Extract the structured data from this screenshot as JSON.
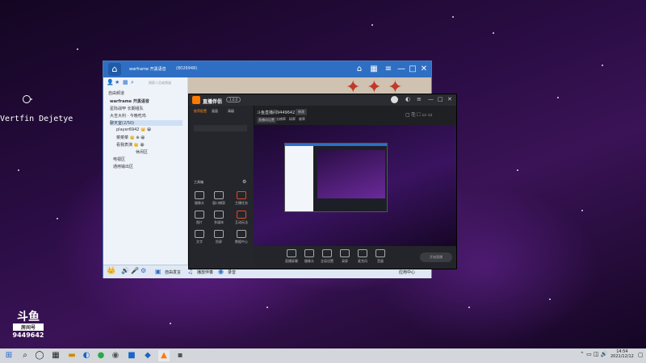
{
  "desktop": {
    "overlay_text": "Vertfin Dejetye"
  },
  "chat_app": {
    "title": "warframe 开黑语音",
    "channel_id": "(8026948)",
    "search_placeholder": "搜索人员或频道",
    "channels": [
      {
        "label": "自由频道"
      },
      {
        "label": "warframe 开黑语音"
      },
      {
        "label": "星际战甲 长期组队"
      },
      {
        "label": "大吉大利 · 今晚吃鸡"
      },
      {
        "label": "聊天室(2/50)"
      },
      {
        "label": "player6942 👑 😀"
      },
      {
        "label": "菜菜菜 👑 ⊕ 😀"
      },
      {
        "label": "看我表演 👑 😀"
      },
      {
        "label": "休闲区"
      },
      {
        "label": "电视区"
      },
      {
        "label": "通用输出区"
      }
    ],
    "bottom_toolbar": {
      "items": [
        "自由发言",
        "播放伴奏",
        "录音"
      ],
      "right_label": "应用中心"
    }
  },
  "streaming_app": {
    "app_name": "直播伴侣",
    "version_badge": "1.0.0",
    "tabs": [
      "推荐配置",
      "画面",
      "高级"
    ],
    "room_title": "斗鱼直播间9449642",
    "room_button": "修改",
    "scene_tabs": [
      "直播间设置",
      "分辨率",
      "码率",
      "帧率"
    ],
    "section_title": "工具箱",
    "tools": [
      {
        "label": "摄像头",
        "icon": "camera-icon"
      },
      {
        "label": "窗口捕获",
        "icon": "window-icon"
      },
      {
        "label": "主播任务",
        "icon": "task-icon"
      },
      {
        "label": "图片",
        "icon": "image-icon"
      },
      {
        "label": "多媒体",
        "icon": "media-icon"
      },
      {
        "label": "互动玩法",
        "icon": "game-icon"
      },
      {
        "label": "文字",
        "icon": "text-icon"
      },
      {
        "label": "投屏",
        "icon": "cast-icon"
      },
      {
        "label": "数据中心",
        "icon": "data-icon"
      }
    ],
    "controls": [
      "直播屏幕",
      "摄像头",
      "全局设置",
      "录屏",
      "麦克风",
      "音量"
    ],
    "start_button": "开始直播"
  },
  "watermark": {
    "logo": "斗鱼",
    "sub": "房间号",
    "room": "9449642"
  },
  "taskbar": {
    "time": "14:54",
    "date": "2021/12/12"
  }
}
